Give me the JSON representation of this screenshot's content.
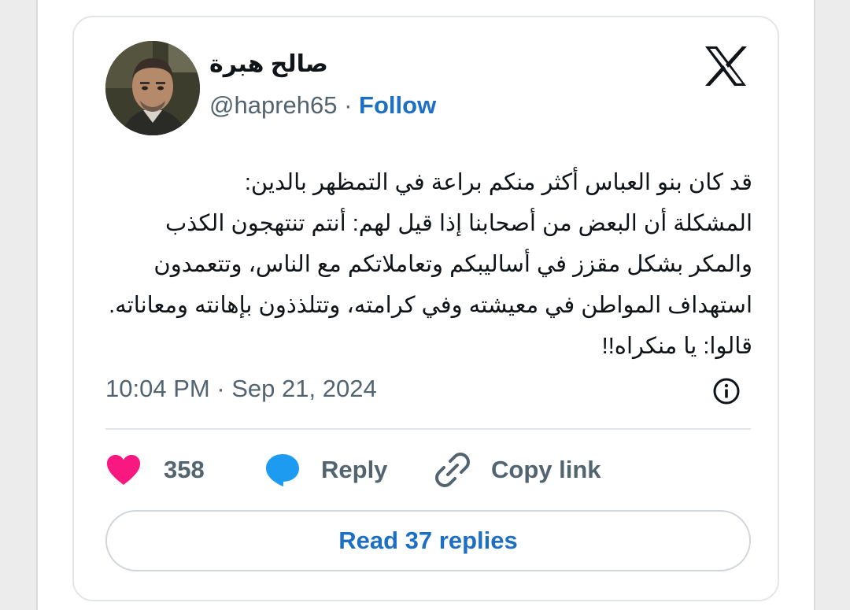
{
  "tweet": {
    "author": {
      "display_name": "صالح هبرة",
      "handle": "@hapreh65",
      "separator": " · ",
      "follow_label": "Follow"
    },
    "text": "قد كان بنو العباس أكثر منكم براعة في التمظهر بالدين:\nالمشكلة أن البعض من أصحابنا إذا قيل لهم: أنتم تنتهجون الكذب والمكر بشكل مقزز في أساليبكم وتعاملاتكم مع الناس، وتتعمدون استهداف المواطن في معيشته وفي كرامته، وتتلذذون بإهانته ومعاناته. قالوا: يا منكراه!!",
    "timestamp": "10:04 PM · Sep 21, 2024",
    "actions": {
      "like_count": "358",
      "reply_label": "Reply",
      "copy_link_label": "Copy link"
    },
    "read_replies_label": "Read 37 replies"
  },
  "icons": {
    "platform_logo": "x-logo-icon",
    "info": "info-icon",
    "like": "heart-icon",
    "reply": "speech-bubble-icon",
    "copy_link": "link-icon"
  },
  "colors": {
    "text_primary": "#0f1419",
    "text_secondary": "#536471",
    "accent_blue": "#1d6fc4",
    "heart_pink": "#f91880",
    "reply_blue": "#1d9bf0",
    "border": "#e3e6e9"
  }
}
